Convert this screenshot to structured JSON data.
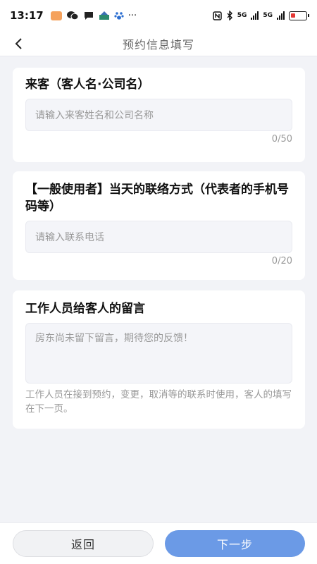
{
  "status_bar": {
    "time": "13:17",
    "more": "···",
    "net1": "5G",
    "net2": "5G"
  },
  "nav": {
    "title": "预约信息填写",
    "back_icon": "chevron-left-icon"
  },
  "guest": {
    "title": "来客（客人名·公司名）",
    "placeholder": "请输入来客姓名和公司名称",
    "counter": "0/50"
  },
  "contact": {
    "title": "【一般使用者】当天的联络方式（代表者的手机号码等）",
    "placeholder": "请输入联系电话",
    "counter": "0/20"
  },
  "message": {
    "title": "工作人员给客人的留言",
    "text": "房东尚未留下留言，期待您的反馈！",
    "hint": "工作人员在接到预约，变更，取消等的联系时使用，客人的填写在下一页。"
  },
  "footer": {
    "back_label": "返回",
    "next_label": "下一步"
  },
  "colors": {
    "accent": "#6b9ae6",
    "background": "#f2f3f7"
  }
}
